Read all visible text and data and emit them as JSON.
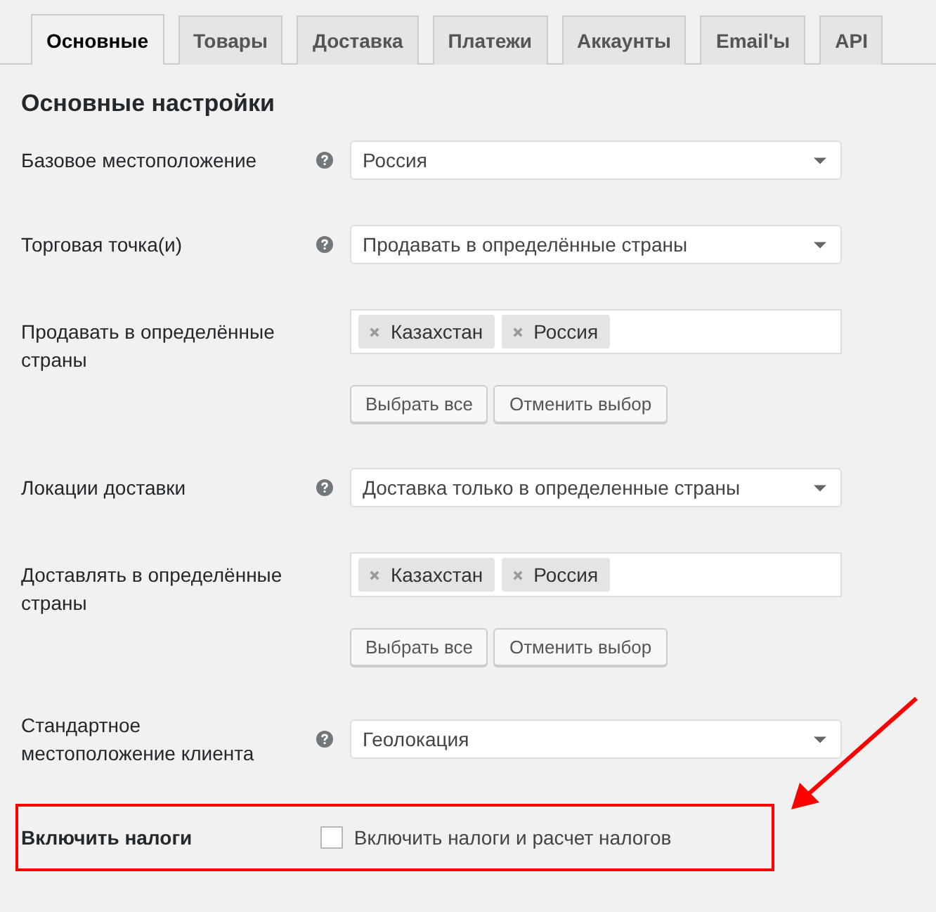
{
  "tabs": [
    {
      "label": "Основные",
      "selected": true
    },
    {
      "label": "Товары",
      "selected": false
    },
    {
      "label": "Доставка",
      "selected": false
    },
    {
      "label": "Платежи",
      "selected": false
    },
    {
      "label": "Аккаунты",
      "selected": false
    },
    {
      "label": "Email'ы",
      "selected": false
    },
    {
      "label": "API",
      "selected": false
    }
  ],
  "heading": "Основные настройки",
  "rows": [
    {
      "kind": "select",
      "label": "Базовое местоположение",
      "help": true,
      "value": "Россия"
    },
    {
      "kind": "select",
      "label": "Торговая точка(и)",
      "help": true,
      "value": "Продавать в определённые страны"
    },
    {
      "kind": "multiselect",
      "label": "Продавать в определённые страны",
      "help": false,
      "tags": [
        "Казахстан",
        "Россия"
      ],
      "buttons": [
        "Выбрать все",
        "Отменить выбор"
      ]
    },
    {
      "kind": "select",
      "label": "Локации доставки",
      "help": true,
      "value": "Доставка только в определенные страны"
    },
    {
      "kind": "multiselect",
      "label": "Доставлять в определённые страны",
      "help": false,
      "tags": [
        "Казахстан",
        "Россия"
      ],
      "buttons": [
        "Выбрать все",
        "Отменить выбор"
      ]
    },
    {
      "kind": "select",
      "label": "Стандартное местоположение клиента",
      "help": true,
      "value": "Геолокация"
    },
    {
      "kind": "checkbox",
      "label": "Включить налоги",
      "help": false,
      "checked": false,
      "text": "Включить налоги и расчет налогов",
      "highlighted": true
    }
  ]
}
